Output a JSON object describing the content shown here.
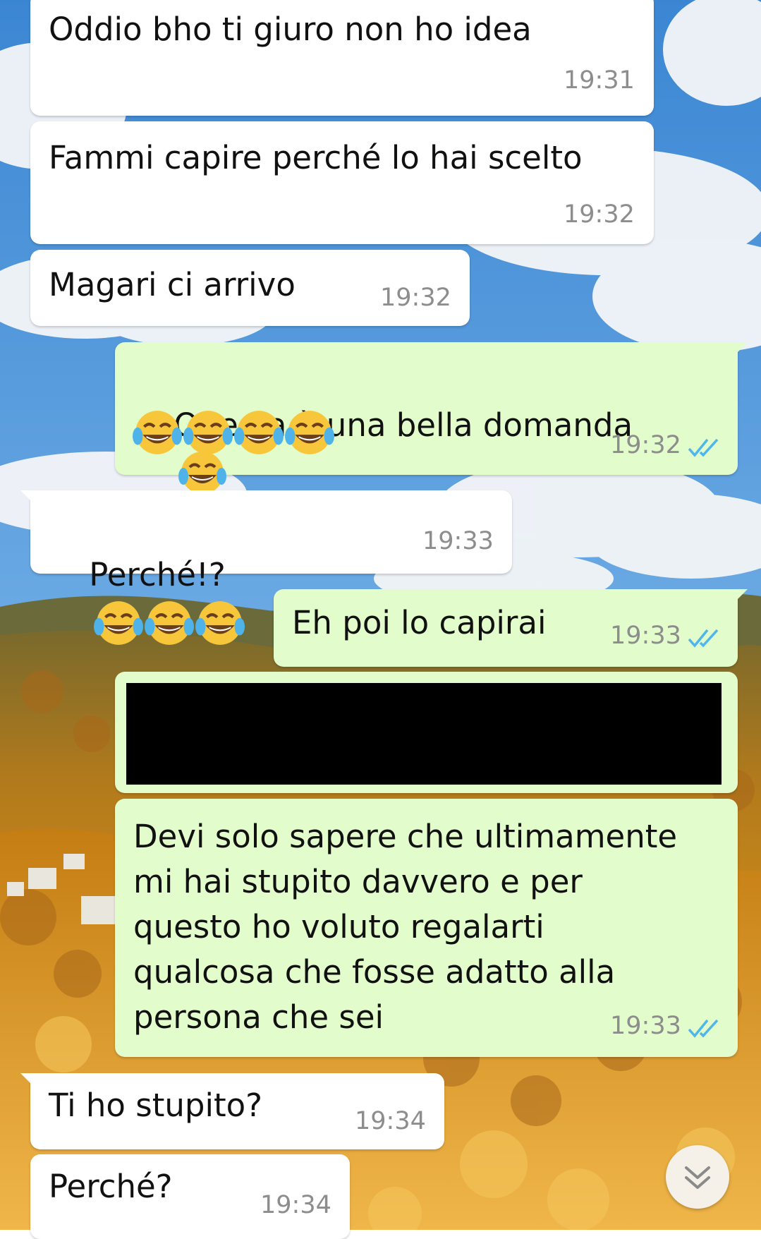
{
  "messages": [
    {
      "text": "Oddio bho ti giuro non ho idea",
      "time": "19:31"
    },
    {
      "text": "Fammi capire perché lo hai scelto",
      "time": "19:32"
    },
    {
      "text": "Magari ci arrivo",
      "time": "19:32"
    },
    {
      "text": "Questa è una bella domanda",
      "time": "19:32"
    },
    {
      "text": "Perché!?",
      "time": "19:33"
    },
    {
      "text": "Eh poi lo capirai",
      "time": "19:33"
    },
    {
      "text": "Devi solo sapere che ultimamente\nmi hai stupito davvero e per\nquesto ho voluto regalarti\nqualcosa che fosse adatto alla\npersona che sei",
      "time": "19:33"
    },
    {
      "text": "Ti ho stupito?",
      "time": "19:34"
    },
    {
      "text": "Perché?",
      "time": "19:34"
    }
  ],
  "icons": {
    "read_receipt": "double-check-blue-icon",
    "emoji": "face-with-tears-of-joy",
    "scroll_down": "double-chevron-down-icon"
  },
  "colors": {
    "incoming_bubble": "#ffffff",
    "outgoing_bubble": "#e2fdcb",
    "timestamp": "#8d8d8d",
    "read_tick": "#4fb6ec",
    "redaction": "#000000"
  }
}
